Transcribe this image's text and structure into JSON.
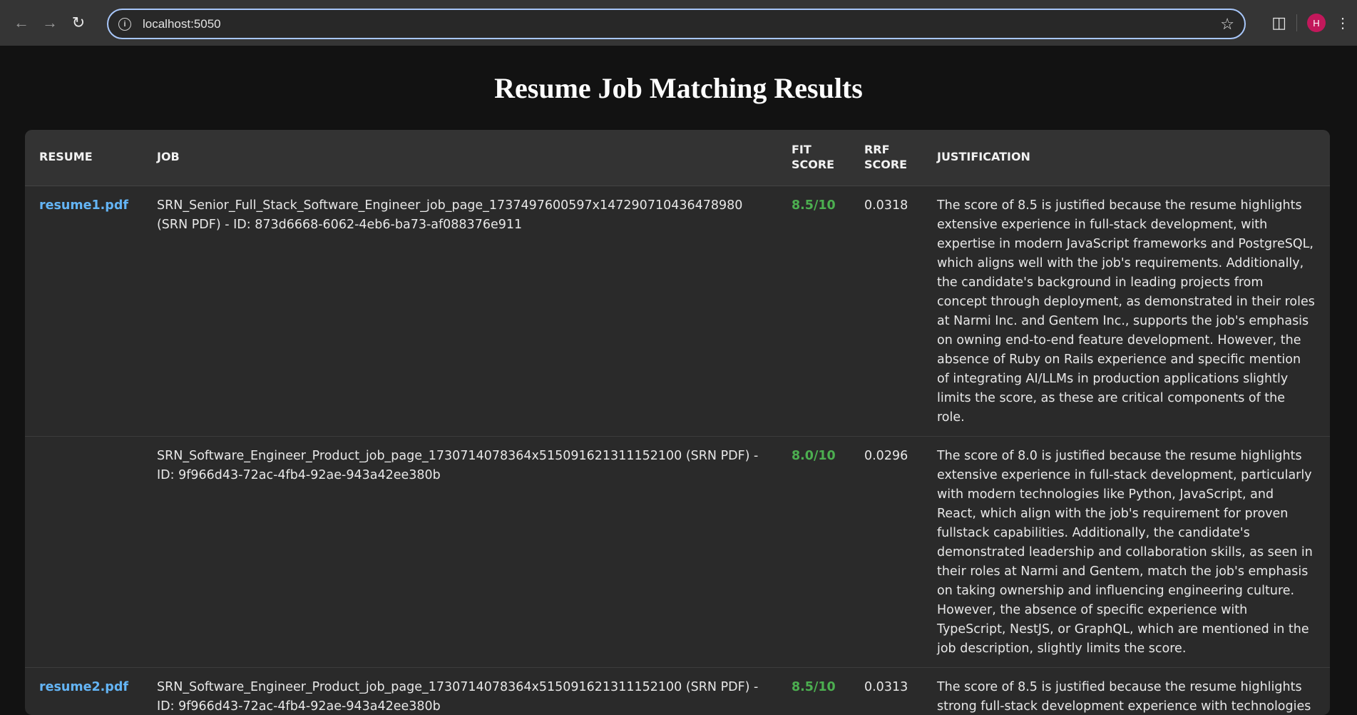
{
  "browser": {
    "url": "localhost:5050",
    "avatar_initial": "H",
    "avatar_color": "#c2185b"
  },
  "page": {
    "title": "Resume Job Matching Results"
  },
  "table": {
    "headers": {
      "resume": "RESUME",
      "job": "JOB",
      "fit_score": "FIT SCORE",
      "rrf_score": "RRF SCORE",
      "justification": "JUSTIFICATION"
    },
    "rows": [
      {
        "resume": "resume1.pdf",
        "job": "SRN_Senior_Full_Stack_Software_Engineer_job_page_1737497600597x147290710436478980 (SRN PDF) - ID: 873d6668-6062-4eb6-ba73-af088376e911",
        "fit_score": "8.5/10",
        "rrf_score": "0.0318",
        "justification": "The score of 8.5 is justified because the resume highlights extensive experience in full-stack development, with expertise in modern JavaScript frameworks and PostgreSQL, which aligns well with the job's requirements. Additionally, the candidate's background in leading projects from concept through deployment, as demonstrated in their roles at Narmi Inc. and Gentem Inc., supports the job's emphasis on owning end-to-end feature development. However, the absence of Ruby on Rails experience and specific mention of integrating AI/LLMs in production applications slightly limits the score, as these are critical components of the role."
      },
      {
        "resume": "",
        "job": "SRN_Software_Engineer_Product_job_page_1730714078364x515091621311152100 (SRN PDF) - ID: 9f966d43-72ac-4fb4-92ae-943a42ee380b",
        "fit_score": "8.0/10",
        "rrf_score": "0.0296",
        "justification": "The score of 8.0 is justified because the resume highlights extensive experience in full-stack development, particularly with modern technologies like Python, JavaScript, and React, which align with the job's requirement for proven fullstack capabilities. Additionally, the candidate's demonstrated leadership and collaboration skills, as seen in their roles at Narmi and Gentem, match the job's emphasis on taking ownership and influencing engineering culture. However, the absence of specific experience with TypeScript, NestJS, or GraphQL, which are mentioned in the job description, slightly limits the score."
      },
      {
        "resume": "resume2.pdf",
        "job": "SRN_Software_Engineer_Product_job_page_1730714078364x515091621311152100 (SRN PDF) - ID: 9f966d43-72ac-4fb4-92ae-943a42ee380b",
        "fit_score": "8.5/10",
        "rrf_score": "0.0313",
        "justification": "The score of 8.5 is justified because the resume highlights strong full-stack development experience with technologies"
      }
    ]
  }
}
